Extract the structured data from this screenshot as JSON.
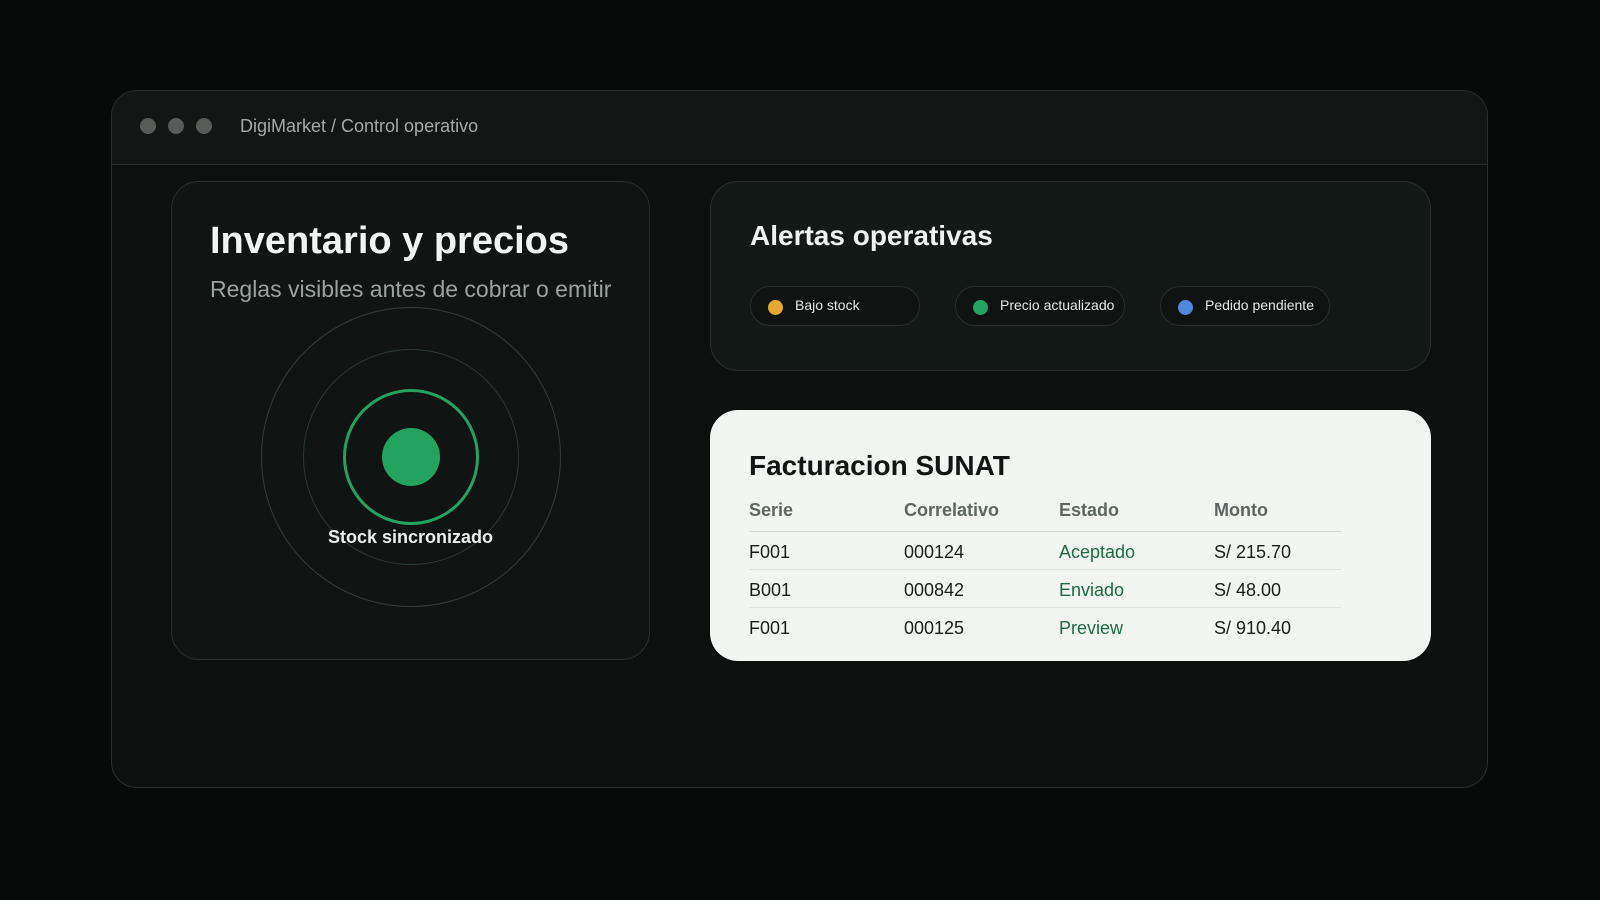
{
  "window": {
    "title": "DigiMarket / Control operativo"
  },
  "inventory": {
    "title": "Inventario y precios",
    "subtitle": "Reglas visibles antes de cobrar o emitir",
    "status_label": "Stock sincronizado"
  },
  "alerts": {
    "title": "Alertas operativas",
    "items": [
      {
        "label": "Bajo stock",
        "color": "#e8a933"
      },
      {
        "label": "Precio actualizado",
        "color": "#23a35f"
      },
      {
        "label": "Pedido pendiente",
        "color": "#4f86de"
      }
    ]
  },
  "billing": {
    "title": "Facturacion SUNAT",
    "columns": [
      "Serie",
      "Correlativo",
      "Estado",
      "Monto"
    ],
    "rows": [
      [
        "F001",
        "000124",
        "Aceptado",
        "S/ 215.70"
      ],
      [
        "B001",
        "000842",
        "Enviado",
        "S/ 48.00"
      ],
      [
        "F001",
        "000125",
        "Preview",
        "S/ 910.40"
      ]
    ]
  },
  "colors": {
    "accent": "#23a35f",
    "status_text": "#1f6b43",
    "background": "#070a09"
  }
}
